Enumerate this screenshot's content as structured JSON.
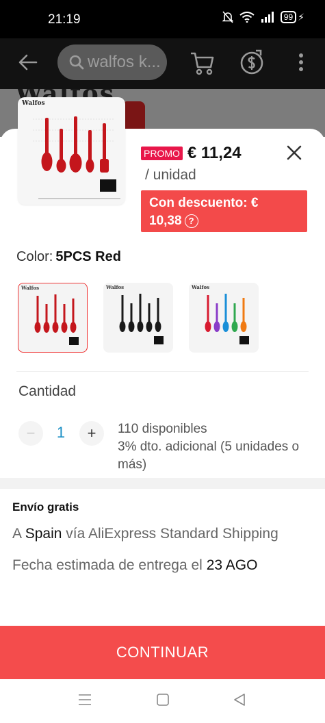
{
  "status_bar": {
    "time": "21:19",
    "battery": "99"
  },
  "header": {
    "search_text": "walfos k...",
    "icons": [
      "back-arrow-icon",
      "search-icon",
      "cart-icon",
      "coin-icon",
      "more-icon"
    ]
  },
  "background_product": {
    "brand_text": "Walfos"
  },
  "product": {
    "thumbnail_brand": "Walfos",
    "promo_badge": "PROMO",
    "price": "€ 11,24",
    "unit": "/ unidad",
    "discount_line1": "Con descuento: €",
    "discount_line2": "10,38",
    "discount_help": "?"
  },
  "color": {
    "label": "Color:",
    "selected": "5PCS Red",
    "variants": [
      {
        "name": "5PCS Red",
        "colors": [
          "#c4161c",
          "#c4161c",
          "#c4161c",
          "#c4161c",
          "#c4161c"
        ],
        "selected": true
      },
      {
        "name": "5PCS Black",
        "colors": [
          "#1a1a1a",
          "#1a1a1a",
          "#1a1a1a",
          "#1a1a1a",
          "#1a1a1a"
        ],
        "selected": false
      },
      {
        "name": "5PCS Multicolor",
        "colors": [
          "#d81b30",
          "#8a3cc8",
          "#1a8fd8",
          "#2fa84f",
          "#f07a12"
        ],
        "selected": false
      }
    ]
  },
  "quantity": {
    "label": "Cantidad",
    "minus": "−",
    "value": "1",
    "plus": "+",
    "available": "110 disponibles",
    "extra_discount": "3% dto. adicional (5 unidades o más)"
  },
  "shipping": {
    "title": "Envío gratis",
    "prefix": "A",
    "country": "Spain",
    "method": "vía AliExpress Standard Shipping",
    "date_prefix": "Fecha estimada de entrega el",
    "date": "23 AGO"
  },
  "actions": {
    "continue": "CONTINUAR"
  },
  "colors": {
    "accent_red": "#f44c4c",
    "promo_pink": "#e8174a",
    "quantity_blue": "#1a8fc5"
  }
}
